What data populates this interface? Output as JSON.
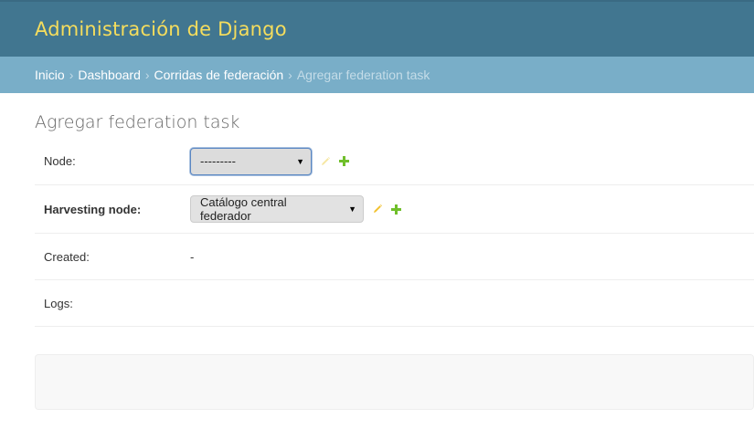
{
  "header": {
    "site_title": "Administración de Django"
  },
  "breadcrumbs": {
    "items": [
      "Inicio",
      "Dashboard",
      "Corridas de federación"
    ],
    "current": "Agregar federation task",
    "separator": "›"
  },
  "page": {
    "title": "Agregar federation task"
  },
  "form": {
    "node": {
      "label": "Node:",
      "value": "---------"
    },
    "harvesting_node": {
      "label": "Harvesting node:",
      "value": "Catálogo central federador"
    },
    "created": {
      "label": "Created:",
      "value": "-"
    },
    "logs": {
      "label": "Logs:"
    }
  },
  "icons": {
    "arrow": "▼",
    "edit": "pencil-icon",
    "add": "plus-icon"
  },
  "colors": {
    "header_bg": "#417690",
    "site_title": "#f5dd5d",
    "breadcrumbs_bg": "#79aec8",
    "edit_icon_active": "#f2c12e",
    "edit_icon_disabled": "#f6e7a3",
    "add_icon": "#70bf2b"
  }
}
